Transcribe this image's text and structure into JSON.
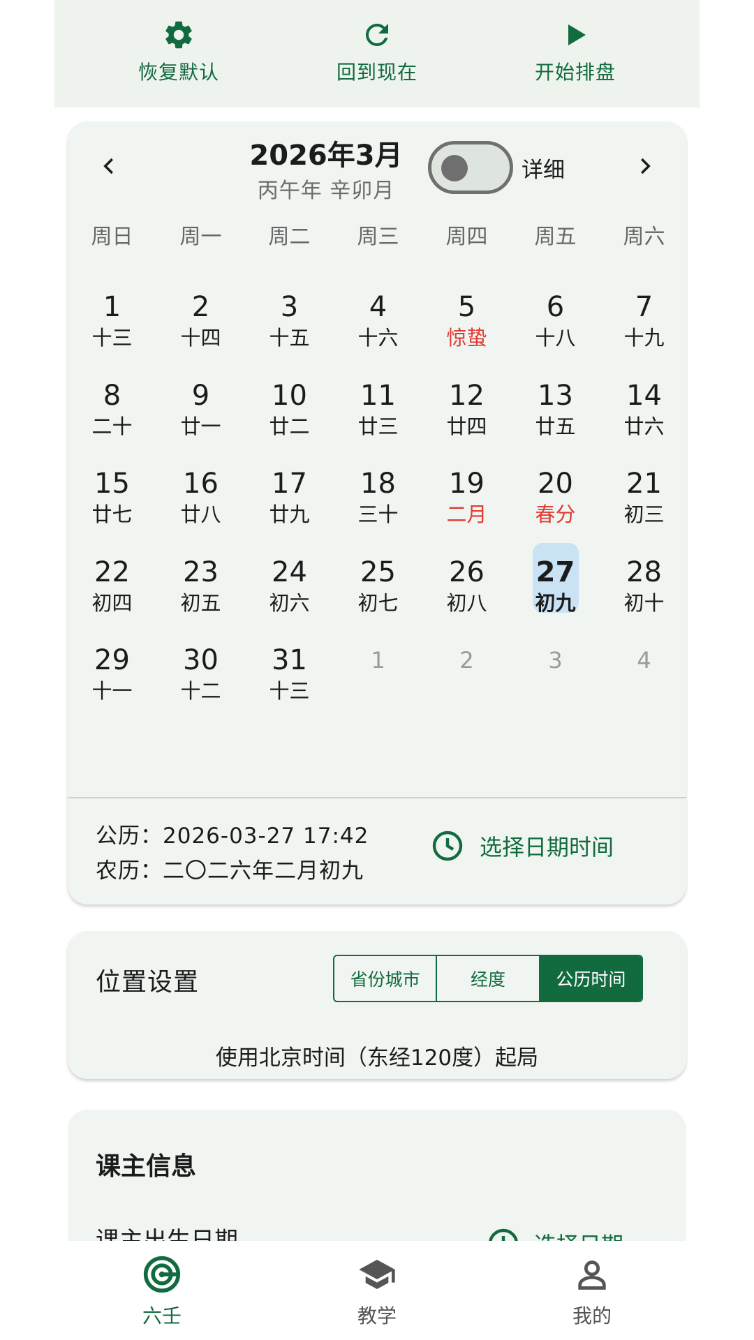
{
  "colors": {
    "accent": "#116b3f",
    "red": "#e03b33",
    "selected_bg": "#c9e2f4",
    "card_bg": "#f1f5f1"
  },
  "toolbar": {
    "reset": {
      "label": "恢复默认",
      "icon": "gear-icon"
    },
    "now": {
      "label": "回到现在",
      "icon": "refresh-icon"
    },
    "start": {
      "label": "开始排盘",
      "icon": "play-icon"
    }
  },
  "calendar": {
    "title": "2026年3月",
    "subtitle": "丙午年 辛卯月",
    "detail_label": "详细",
    "detail_toggle_on": false,
    "weekdays": [
      "周日",
      "周一",
      "周二",
      "周三",
      "周四",
      "周五",
      "周六"
    ],
    "days": [
      {
        "n": "1",
        "l": "十三"
      },
      {
        "n": "2",
        "l": "十四"
      },
      {
        "n": "3",
        "l": "十五"
      },
      {
        "n": "4",
        "l": "十六"
      },
      {
        "n": "5",
        "l": "惊蛰",
        "red": true
      },
      {
        "n": "6",
        "l": "十八"
      },
      {
        "n": "7",
        "l": "十九"
      },
      {
        "n": "8",
        "l": "二十"
      },
      {
        "n": "9",
        "l": "廿一"
      },
      {
        "n": "10",
        "l": "廿二"
      },
      {
        "n": "11",
        "l": "廿三"
      },
      {
        "n": "12",
        "l": "廿四"
      },
      {
        "n": "13",
        "l": "廿五"
      },
      {
        "n": "14",
        "l": "廿六"
      },
      {
        "n": "15",
        "l": "廿七"
      },
      {
        "n": "16",
        "l": "廿八"
      },
      {
        "n": "17",
        "l": "廿九"
      },
      {
        "n": "18",
        "l": "三十"
      },
      {
        "n": "19",
        "l": "二月",
        "red": true
      },
      {
        "n": "20",
        "l": "春分",
        "red": true
      },
      {
        "n": "21",
        "l": "初三"
      },
      {
        "n": "22",
        "l": "初四"
      },
      {
        "n": "23",
        "l": "初五"
      },
      {
        "n": "24",
        "l": "初六"
      },
      {
        "n": "25",
        "l": "初七"
      },
      {
        "n": "26",
        "l": "初八"
      },
      {
        "n": "27",
        "l": "初九",
        "selected": true
      },
      {
        "n": "28",
        "l": "初十"
      },
      {
        "n": "29",
        "l": "十一"
      },
      {
        "n": "30",
        "l": "十二"
      },
      {
        "n": "31",
        "l": "十三"
      },
      {
        "n": "1",
        "l": "",
        "other": true
      },
      {
        "n": "2",
        "l": "",
        "other": true
      },
      {
        "n": "3",
        "l": "",
        "other": true
      },
      {
        "n": "4",
        "l": "",
        "other": true
      }
    ],
    "solar_text": "公历：2026-03-27 17:42",
    "lunar_text": "农历：二〇二六年二月初九",
    "pick_label": "选择日期时间"
  },
  "location": {
    "title": "位置设置",
    "tabs": [
      "省份城市",
      "经度",
      "公历时间"
    ],
    "active_tab": "公历时间",
    "note": "使用北京时间（东经120度）起局"
  },
  "client": {
    "title": "课主信息",
    "birth_label": "课主出生日期",
    "pick_label": "选择日期"
  },
  "bottom_nav": [
    {
      "label": "六壬",
      "icon": "target-icon",
      "active": true
    },
    {
      "label": "教学",
      "icon": "graduation-cap-icon",
      "active": false
    },
    {
      "label": "我的",
      "icon": "person-icon",
      "active": false
    }
  ]
}
